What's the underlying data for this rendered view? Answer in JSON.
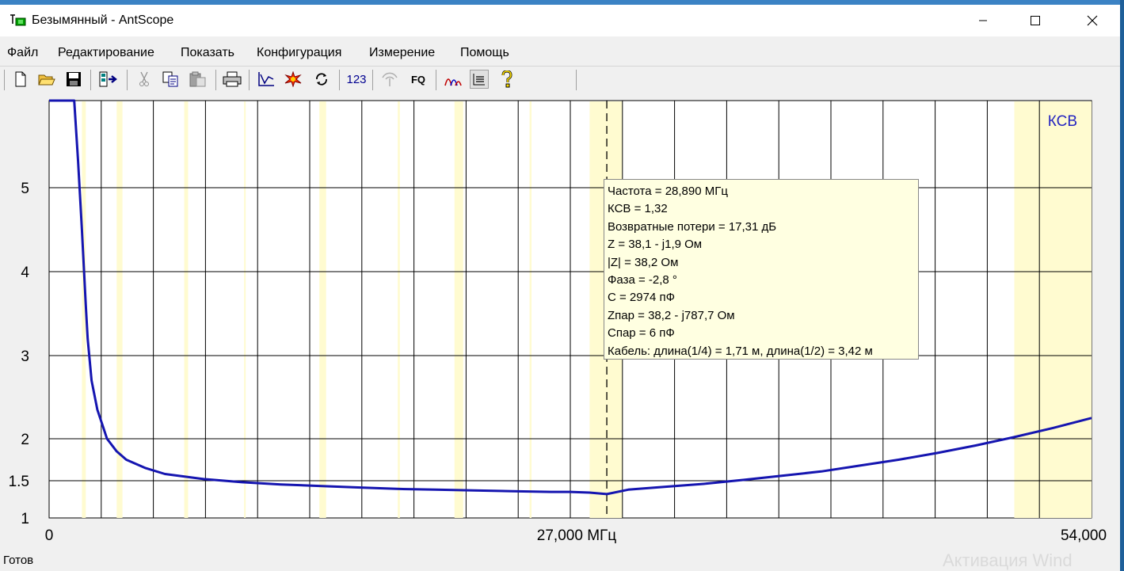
{
  "window": {
    "title": "Безымянный - AntScope",
    "status": "Готов"
  },
  "menu": [
    "Файл",
    "Редактирование",
    "Показать",
    "Конфигурация",
    "Измерение",
    "Помощь"
  ],
  "toolbar": {
    "icons": [
      "new-file-icon",
      "open-folder-icon",
      "save-icon",
      "export-icon",
      "cut-icon",
      "copy-icon",
      "paste-icon",
      "print-icon",
      "chart-icon",
      "burst-icon",
      "refresh-icon",
      "numbers-icon",
      "antenna-icon",
      "fq-icon",
      "graph-icon",
      "list-icon",
      "help-icon"
    ],
    "numbers_label": "123",
    "fq_label": "FQ"
  },
  "chart_data": {
    "type": "line",
    "series": [
      {
        "name": "КСВ",
        "x": [
          0,
          0.8,
          1.3,
          1.5,
          1.7,
          1.9,
          2.0,
          2.2,
          2.5,
          3.0,
          3.5,
          4.0,
          5,
          6,
          8,
          10,
          12,
          14,
          16,
          18,
          20,
          22,
          24,
          26,
          27,
          28,
          28.89,
          30,
          32,
          34,
          36,
          38,
          40,
          42,
          44,
          46,
          48,
          50,
          52,
          54
        ],
        "y": [
          6.0,
          6.0,
          6.0,
          5.3,
          4.5,
          3.6,
          3.2,
          2.7,
          2.35,
          2.0,
          1.85,
          1.75,
          1.65,
          1.58,
          1.52,
          1.48,
          1.45,
          1.43,
          1.41,
          1.39,
          1.38,
          1.37,
          1.36,
          1.35,
          1.35,
          1.34,
          1.32,
          1.38,
          1.42,
          1.46,
          1.51,
          1.56,
          1.61,
          1.68,
          1.75,
          1.83,
          1.92,
          2.02,
          2.13,
          2.25
        ],
        "color": "#1515b0"
      }
    ],
    "y_ticks": [
      "5",
      "4",
      "3",
      "2",
      "1.5",
      "1"
    ],
    "x_ticks": [
      "0",
      "27,000 МГц",
      "54,000"
    ],
    "xlim": [
      0,
      54
    ],
    "ylim": [
      1,
      6
    ],
    "grid": true,
    "legend": "top-right",
    "cursor_x": 28.89,
    "highlight_bands": [
      [
        1.7,
        1.9
      ],
      [
        3.5,
        3.8
      ],
      [
        7.0,
        7.2
      ],
      [
        10.1,
        10.15
      ],
      [
        14.0,
        14.35
      ],
      [
        18.06,
        18.17
      ],
      [
        21.0,
        21.45
      ],
      [
        24.89,
        24.99
      ],
      [
        28.0,
        29.7
      ],
      [
        50.0,
        54.0
      ]
    ]
  },
  "tooltip": {
    "lines": [
      "Частота = 28,890 МГц",
      "КСВ = 1,32",
      "Возвратные потери = 17,31 дБ",
      "Z = 38,1 - j1,9 Ом",
      "|Z| = 38,2 Ом",
      "Фаза = -2,8 °",
      "C = 2974 пФ",
      "Zпар = 38,2 - j787,7 Ом",
      "Cпар = 6 пФ",
      "Кабель: длина(1/4) = 1,71 м, длина(1/2) = 3,42 м"
    ]
  },
  "watermark": "Активация Wind"
}
